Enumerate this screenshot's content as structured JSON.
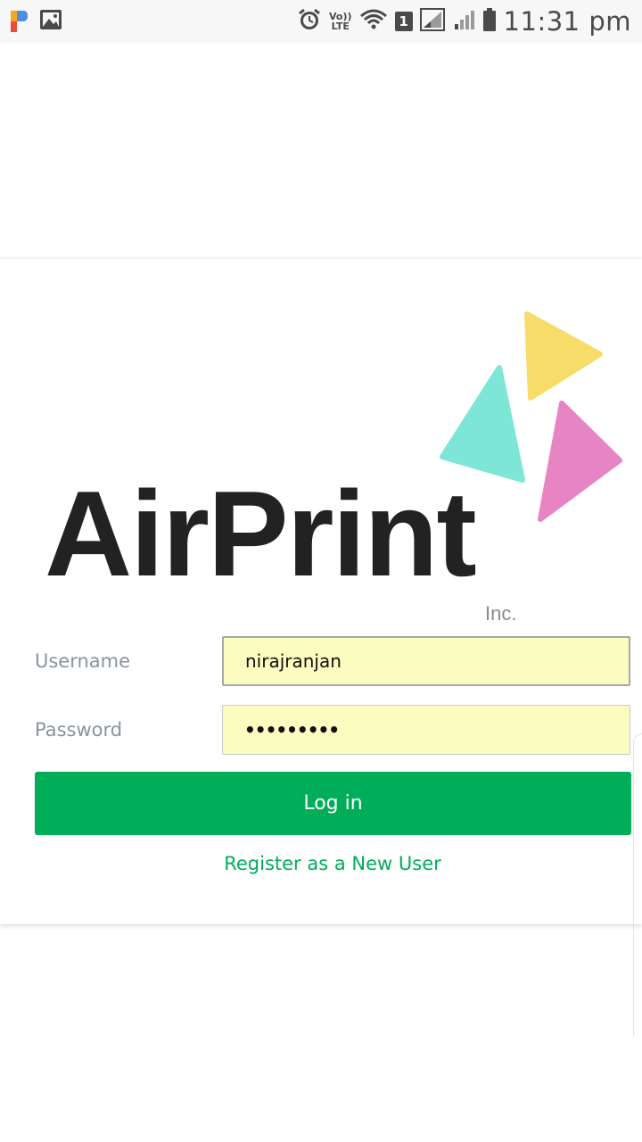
{
  "status_bar": {
    "volte_top": "Vo))",
    "volte_bottom": "LTE",
    "sim_number": "1",
    "time": "11:31 pm",
    "icons": [
      "app-icon",
      "gallery-icon",
      "alarm-icon",
      "volte-icon",
      "wifi-icon",
      "sim-icon",
      "signal-icon",
      "signal-weak-icon",
      "battery-icon"
    ]
  },
  "logo": {
    "text": "AirPrint",
    "suffix": "Inc.",
    "colors": {
      "yellow": "#f7dc6a",
      "teal": "#7de6d7",
      "pink": "#e784c4",
      "text": "#222222"
    }
  },
  "form": {
    "username_label": "Username",
    "username_value": "nirajranjan",
    "password_label": "Password",
    "password_value": "•••••••••",
    "login_label": "Log in",
    "register_label": "Register as a New User"
  },
  "colors": {
    "accent": "#00ae5a",
    "input_bg": "#fafcc0"
  }
}
